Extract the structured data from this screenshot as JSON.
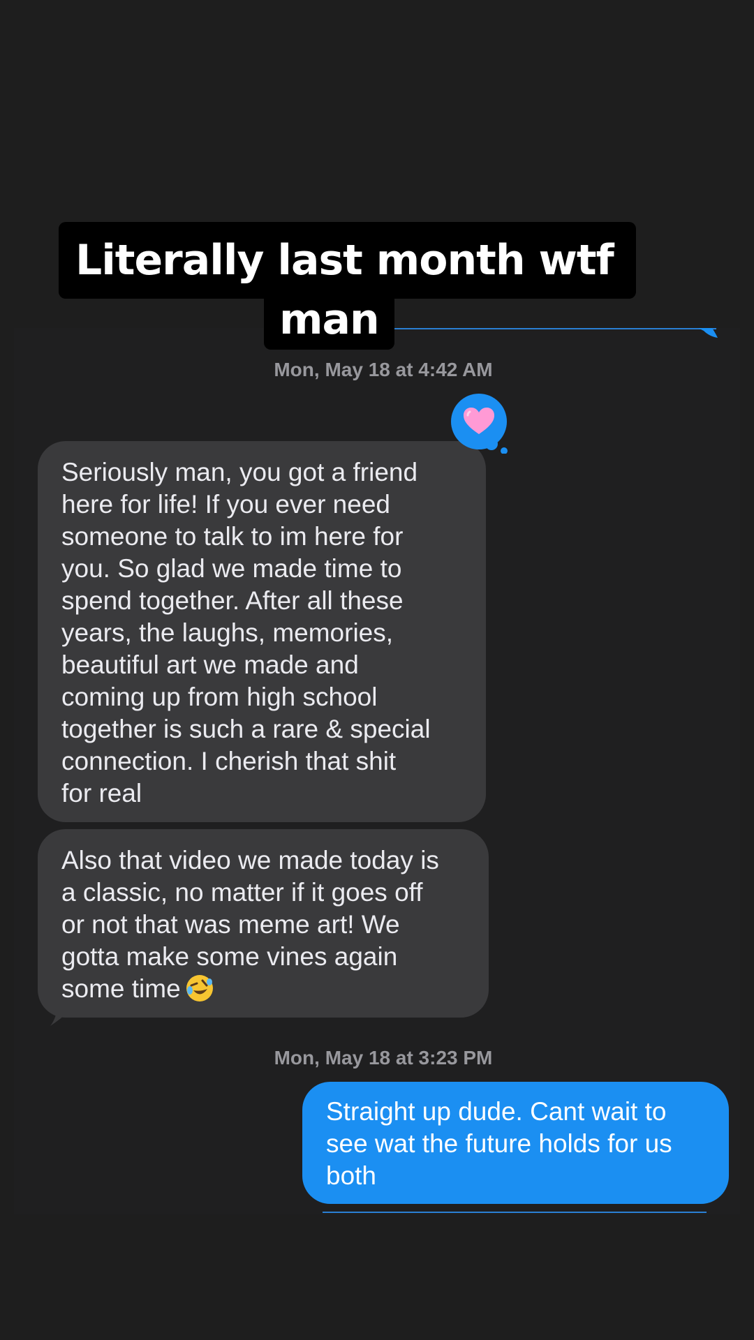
{
  "caption": {
    "line1": "Literally last month wtf",
    "line2": "man"
  },
  "timestamps": {
    "first": "Mon, May 18 at 4:42 AM",
    "second": "Mon, May 18 at 3:23 PM"
  },
  "messages": [
    {
      "sender": "them",
      "text": "Seriously man, you got a friend\nhere for life! If you ever need\nsomeone to talk to im here for\nyou. So glad we made time to\nspend together. After all these\nyears, the laughs, memories,\nbeautiful art we made and\ncoming up from high school\ntogether is such a rare & special\nconnection. I cherish that shit\nfor real",
      "reaction": "heart"
    },
    {
      "sender": "them",
      "text": "Also that video we made today is\na classic, no matter if it goes off\nor not that was meme art! We\ngotta make some vines again\nsome time",
      "emoji": "rolling-on-floor-laughing"
    },
    {
      "sender": "me",
      "text": "Straight up dude. Cant wait to\nsee wat the future holds for us\nboth"
    }
  ],
  "colors": {
    "background": "#1e1e1e",
    "incoming_bubble": "#3a3a3c",
    "outgoing_bubble": "#1b8ff2",
    "timestamp": "#98989d",
    "tapback_bg": "#1b8ff2",
    "heart": "#ff9ad5"
  }
}
